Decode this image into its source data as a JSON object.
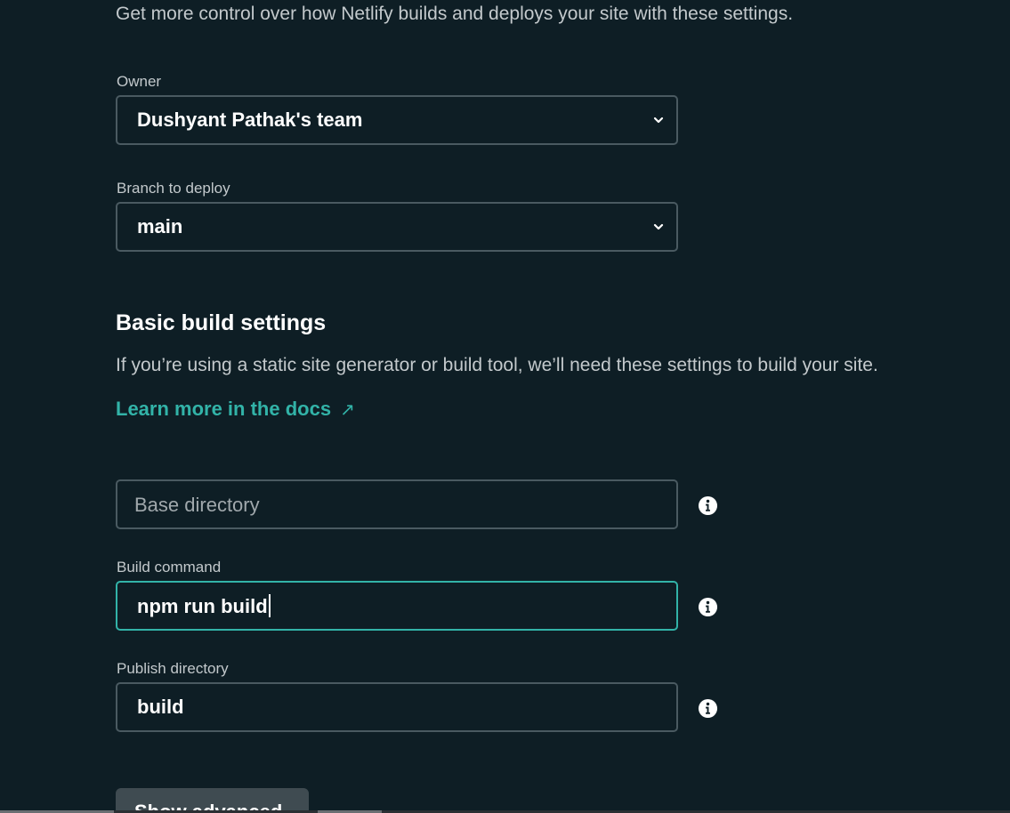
{
  "intro": "Get more control over how Netlify builds and deploys your site with these settings.",
  "owner": {
    "label": "Owner",
    "value": "Dushyant Pathak's team"
  },
  "branch": {
    "label": "Branch to deploy",
    "value": "main"
  },
  "basic_build": {
    "title": "Basic build settings",
    "description": "If you’re using a static site generator or build tool, we’ll need these settings to build your site.",
    "docs_link": "Learn more in the docs",
    "docs_arrow": "↗"
  },
  "base_directory": {
    "placeholder": "Base directory"
  },
  "build_command": {
    "label": "Build command",
    "value": "npm run build"
  },
  "publish_directory": {
    "label": "Publish directory",
    "value": "build"
  },
  "bottom_button": {
    "label": "Show advanced"
  },
  "colors": {
    "background": "#0e1e25",
    "accent": "#32b3a8",
    "border": "#4a5a61",
    "muted_text": "#c3c9cc"
  },
  "icons": {
    "dropdown": "chevron-down-icon",
    "info": "info-icon",
    "external_link": "external-link-arrow-icon"
  }
}
